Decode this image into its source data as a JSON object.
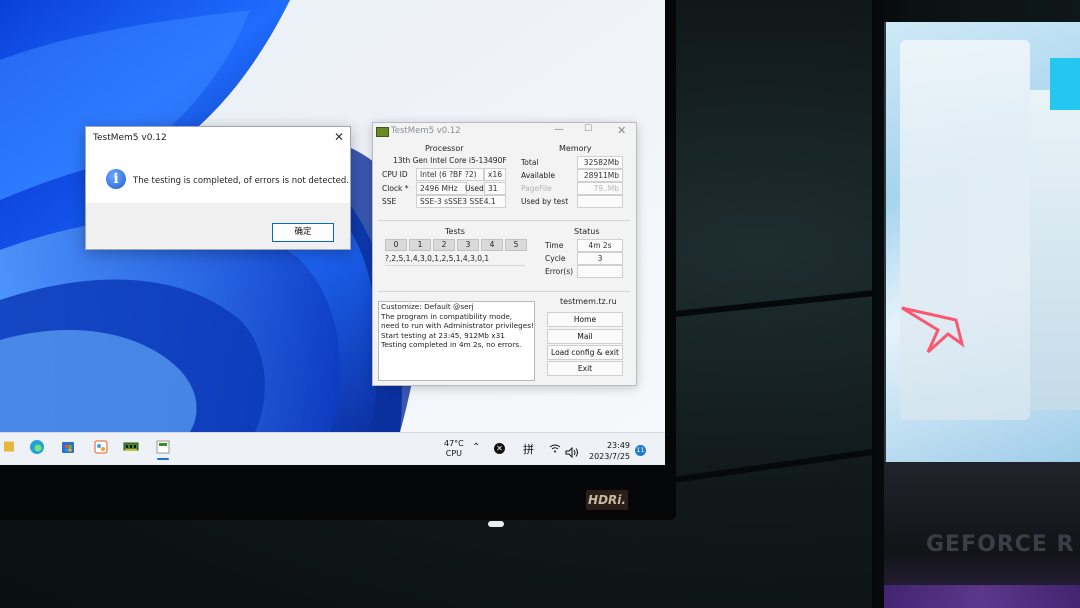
{
  "dialog": {
    "title": "TestMem5 v0.12",
    "close_glyph": "✕",
    "message": "The testing is completed, of errors is not detected.",
    "ok_label": "确定",
    "icon": "info-icon"
  },
  "testmem": {
    "title": "TestMem5 v0.12",
    "processor": {
      "heading": "Processor",
      "name": "13th Gen Intel Core i5-13490F",
      "cpu_id_label": "CPU ID",
      "cpu_id": "Intel  (6 ?BF ?2)",
      "threads": "x16",
      "clock_label": "Clock *",
      "clock": "2496 MHz",
      "used_label": "Used",
      "used": "31",
      "sse_label": "SSE",
      "sse": "SSE-3 sSSE3 SSE4.1"
    },
    "memory": {
      "heading": "Memory",
      "total_label": "Total",
      "total": "32582Mb",
      "available_label": "Available",
      "available": "28911Mb",
      "pagefile_label": "PageFile",
      "pagefile": "79..Mb",
      "used_by_test_label": "Used by test",
      "used_by_test": ""
    },
    "tests": {
      "heading": "Tests",
      "columns": [
        "0",
        "1",
        "2",
        "3",
        "4",
        "5"
      ],
      "sequence": "?,2,5,1,4,3,0,1,2,5,1,4,3,0,1"
    },
    "status": {
      "heading": "Status",
      "time_label": "Time",
      "time": "4m 2s",
      "cycle_label": "Cycle",
      "cycle": "3",
      "errors_label": "Error(s)",
      "errors": ""
    },
    "log": [
      "Customize: Default @serj",
      "The program in compatibility mode,",
      "need to run with Administrator privileges!",
      "Start testing at 23:45, 912Mb x31",
      "Testing completed in 4m 2s, no errors."
    ],
    "site": "testmem.tz.ru",
    "buttons": {
      "home": "Home",
      "mail": "Mail",
      "load": "Load config & exit",
      "exit": "Exit"
    }
  },
  "taskbar": {
    "temp": "47°C",
    "temp_label": "CPU",
    "ime": "拼",
    "time": "23:49",
    "date": "2023/7/25",
    "notification_count": "11",
    "icons": [
      "folder-icon",
      "edge-icon",
      "store-icon",
      "paint-icon",
      "ram-chip-icon",
      "testmem-icon"
    ]
  },
  "hardware": {
    "monitor_brand": "HDRi.",
    "gpu_label": "GEFORCE R"
  }
}
